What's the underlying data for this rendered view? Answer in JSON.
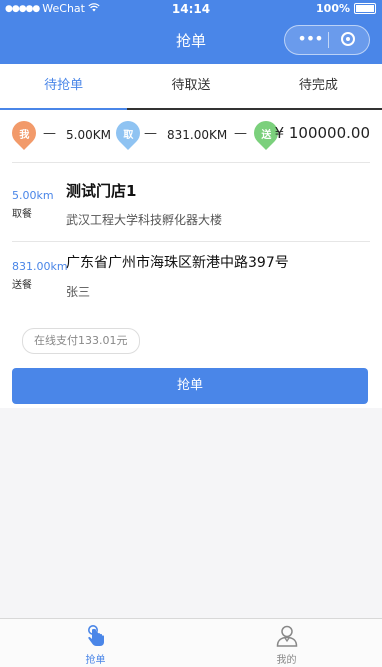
{
  "status_bar": {
    "carrier": "WeChat",
    "time": "14:14",
    "battery": "100%"
  },
  "nav": {
    "title": "抢单"
  },
  "tabs": [
    {
      "label": "待抢单",
      "active": true
    },
    {
      "label": "待取送",
      "active": false
    },
    {
      "label": "待完成",
      "active": false
    }
  ],
  "order": {
    "route": {
      "start_badge": "我",
      "pickup_badge": "取",
      "dropoff_badge": "送",
      "dash": "—",
      "dist_to_pickup": "5.00KM",
      "dist_to_dropoff": "831.00KM",
      "price": "¥ 100000.00"
    },
    "pickup": {
      "distance": "5.00km",
      "tag": "取餐",
      "store_name": "测试门店1",
      "address": "武汉工程大学科技孵化器大楼"
    },
    "dropoff": {
      "distance": "831.00km",
      "tag": "送餐",
      "address": "广东省广州市海珠区新港中路397号",
      "recipient": "张三"
    },
    "payment": "在线支付133.01元",
    "grab_button": "抢单"
  },
  "bottom_nav": [
    {
      "label": "抢单",
      "icon": "hand-tap-icon",
      "active": true
    },
    {
      "label": "我的",
      "icon": "user-icon",
      "active": false
    }
  ],
  "colors": {
    "primary": "#4a86e8",
    "badge_start": "#f29a6a",
    "badge_pickup": "#8fc3f2",
    "badge_dropoff": "#7bd07c"
  }
}
